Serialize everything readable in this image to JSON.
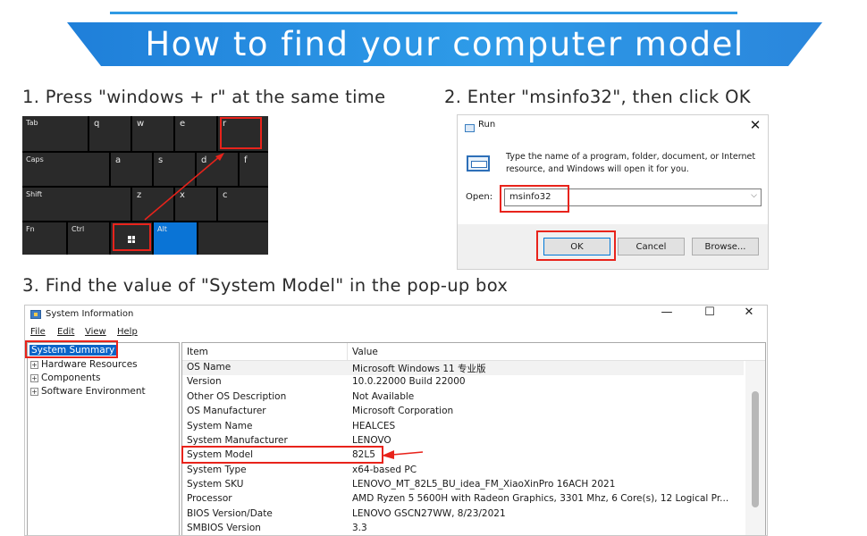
{
  "header": {
    "title": "How to find your computer model"
  },
  "steps": [
    {
      "label": "1. Press \"windows + r\" at the same time"
    },
    {
      "label": "2. Enter \"msinfo32\", then click OK"
    },
    {
      "label": "3. Find the value of \"System Model\" in the pop-up box"
    }
  ],
  "keyboard": {
    "row1": [
      "Tab",
      "q",
      "w",
      "e",
      "r"
    ],
    "row2": [
      "Caps",
      "a",
      "s",
      "d",
      "f"
    ],
    "row3": [
      "Shift",
      "z",
      "x",
      "c"
    ],
    "row4": [
      "Fn",
      "Ctrl",
      "",
      "Alt"
    ]
  },
  "run_dialog": {
    "title": "Run",
    "close": "✕",
    "description": "Type the name of a program, folder, document, or Internet resource, and Windows will open it for you.",
    "open_label": "Open:",
    "input_value": "msinfo32",
    "chevron": "⌵",
    "buttons": {
      "ok": "OK",
      "cancel": "Cancel",
      "browse": "Browse..."
    }
  },
  "sysinfo": {
    "title": "System Information",
    "controls": {
      "minimize": "—",
      "maximize": "☐",
      "close": "✕"
    },
    "menu": [
      "File",
      "Edit",
      "View",
      "Help"
    ],
    "tree": [
      {
        "label": "System Summary",
        "selected": true
      },
      {
        "label": "Hardware Resources",
        "expander": "+"
      },
      {
        "label": "Components",
        "expander": "+"
      },
      {
        "label": "Software Environment",
        "expander": "+"
      }
    ],
    "columns": {
      "item": "Item",
      "value": "Value"
    },
    "rows": [
      {
        "item": "OS Name",
        "value": "Microsoft Windows 11 专业版"
      },
      {
        "item": "Version",
        "value": "10.0.22000 Build 22000"
      },
      {
        "item": "Other OS Description",
        "value": "Not Available"
      },
      {
        "item": "OS Manufacturer",
        "value": "Microsoft Corporation"
      },
      {
        "item": "System Name",
        "value": "HEALCES"
      },
      {
        "item": "System Manufacturer",
        "value": "LENOVO"
      },
      {
        "item": "System Model",
        "value": "82L5"
      },
      {
        "item": "System Type",
        "value": "x64-based PC"
      },
      {
        "item": "System SKU",
        "value": "LENOVO_MT_82L5_BU_idea_FM_XiaoXinPro 16ACH 2021"
      },
      {
        "item": "Processor",
        "value": "AMD Ryzen 5 5600H with Radeon Graphics, 3301 Mhz, 6 Core(s), 12 Logical Pr..."
      },
      {
        "item": "BIOS Version/Date",
        "value": "LENOVO GSCN27WW, 8/23/2021"
      },
      {
        "item": "SMBIOS Version",
        "value": "3.3"
      }
    ]
  },
  "colors": {
    "banner": "#2e9be8",
    "highlight": "#e8231b",
    "selection": "#0a64c8",
    "alt_key": "#0a74d6"
  }
}
